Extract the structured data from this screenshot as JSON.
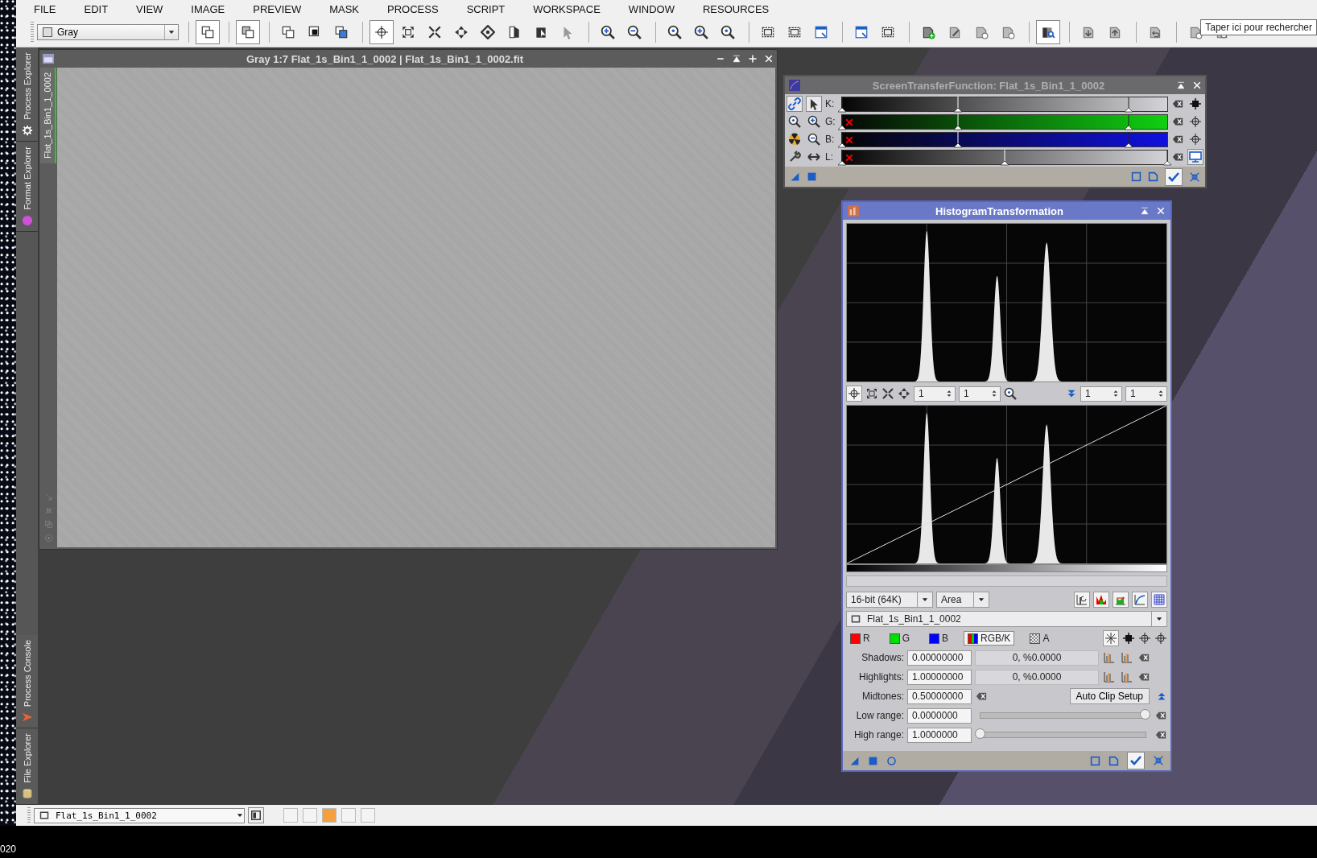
{
  "menu": [
    "FILE",
    "EDIT",
    "VIEW",
    "IMAGE",
    "PREVIEW",
    "MASK",
    "PROCESS",
    "SCRIPT",
    "WORKSPACE",
    "WINDOW",
    "RESOURCES"
  ],
  "toolbar": {
    "view_selector": "Gray",
    "buttons": [
      {
        "selected": true
      },
      {
        "selected": true
      },
      {
        "selected": false
      },
      {
        "selected": false
      },
      {
        "selected": false
      },
      {
        "selected": true
      },
      {
        "selected": false
      },
      {
        "selected": false
      },
      {
        "selected": false
      },
      {
        "selected": false
      },
      {
        "selected": false
      },
      {
        "selected": false
      },
      {
        "selected": false
      },
      {
        "selected": false
      },
      {
        "selected": false
      },
      {
        "selected": false
      },
      {
        "selected": false
      },
      {
        "selected": false
      },
      {
        "selected": false
      },
      {
        "selected": false
      },
      {
        "selected": false
      },
      {
        "selected": false
      },
      {
        "selected": false
      },
      {
        "selected": false
      },
      {
        "selected": false
      },
      {
        "selected": false
      },
      {
        "selected": false
      },
      {
        "selected": true
      },
      {
        "selected": false
      },
      {
        "selected": false
      },
      {
        "selected": false
      },
      {
        "selected": false
      },
      {
        "selected": false
      }
    ]
  },
  "tooltip": "Taper ici pour rechercher",
  "left_dock": {
    "top_tabs": [
      "Process Explorer",
      "Format Explorer"
    ],
    "bottom_tabs": [
      "Process Console",
      "File Explorer"
    ]
  },
  "image_window": {
    "title": "Gray 1:7 Flat_1s_Bin1_1_0002 | Flat_1s_Bin1_1_0002.fit",
    "side_tab": "Flat_1s_Bin1_1_0002"
  },
  "stf": {
    "title": "ScreenTransferFunction: Flat_1s_Bin1_1_0002",
    "channels": [
      {
        "label": "K:",
        "kind": "gray",
        "disabled": false,
        "markers": [
          {
            "level": 0
          },
          {
            "level": 0.357
          },
          {
            "level": 0.882
          }
        ]
      },
      {
        "label": "G:",
        "kind": "green",
        "disabled": true,
        "markers": [
          {
            "level": 0
          },
          {
            "level": 0.357
          },
          {
            "level": 0.882
          }
        ]
      },
      {
        "label": "B:",
        "kind": "blue",
        "disabled": true,
        "markers": [
          {
            "level": 0
          },
          {
            "level": 0.357
          },
          {
            "level": 0.882
          }
        ]
      },
      {
        "label": "L:",
        "kind": "gray",
        "disabled": true,
        "markers": [
          {
            "level": 0
          },
          {
            "level": 0.5
          },
          {
            "level": 1
          }
        ]
      }
    ]
  },
  "histogram": {
    "title": "HistogramTransformation",
    "zoom_fields": [
      "1",
      "1",
      "1",
      "1"
    ],
    "depth": "16-bit (64K)",
    "plot_mode": "Area",
    "view": "Flat_1s_Bin1_1_0002",
    "channels": [
      {
        "label": "R",
        "kind": "color",
        "color": "#ff0000",
        "selected": false
      },
      {
        "label": "G",
        "kind": "color",
        "color": "#00e000",
        "selected": false
      },
      {
        "label": "B",
        "kind": "color",
        "color": "#0000ff",
        "selected": false
      },
      {
        "label": "RGB/K",
        "kind": "combined",
        "selected": true
      },
      {
        "label": "A",
        "kind": "alpha",
        "selected": false
      }
    ],
    "params": [
      {
        "label": "Shadows:",
        "value": "0.00000000",
        "kind": "readout",
        "readout": "0, %0.0000"
      },
      {
        "label": "Highlights:",
        "value": "1.00000000",
        "kind": "readout",
        "readout": "0, %0.0000"
      },
      {
        "label": "Midtones:",
        "value": "0.50000000",
        "kind": "button",
        "button": "Auto Clip Setup"
      },
      {
        "label": "Low range:",
        "value": "0.0000000",
        "kind": "slider",
        "level": 1
      },
      {
        "label": "High range:",
        "value": "1.0000000",
        "kind": "slider",
        "level": 0
      }
    ]
  },
  "status_bar": {
    "view": "Flat_1s_Bin1_1_0002",
    "swatches": [
      {
        "color": "#f4f4f4"
      },
      {
        "color": "#f4f4f4"
      },
      {
        "color": "#f5a040"
      },
      {
        "color": "#f4f4f4"
      },
      {
        "color": "#f4f4f4"
      }
    ]
  },
  "taskbar": {
    "clock_fragment": "020"
  }
}
